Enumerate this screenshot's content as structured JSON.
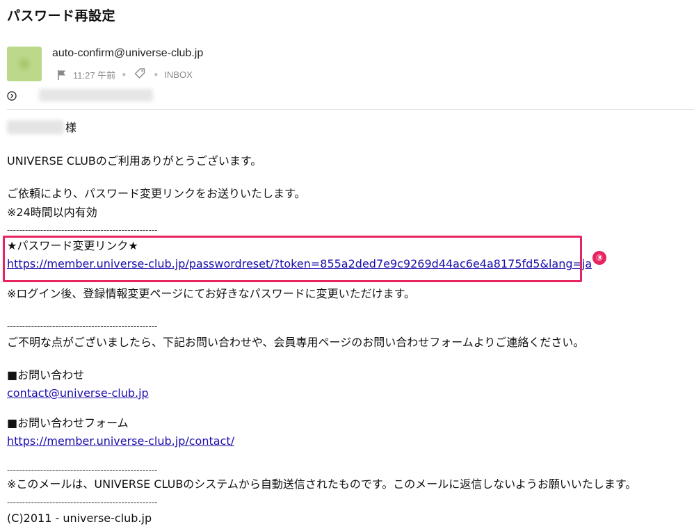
{
  "email": {
    "subject": "パスワード再設定",
    "sender": "auto-confirm@universe-club.jp",
    "time": "11:27 午前",
    "folder": "INBOX"
  },
  "body": {
    "salutation": "様",
    "greeting": "UNIVERSE CLUBのご利用ありがとうございます。",
    "line1": "ご依頼により、パスワード変更リンクをお送りいたします。",
    "line2": "※24時間以内有効",
    "separator": "--------------------------------------------------",
    "link_heading": "★パスワード変更リンク★",
    "reset_link": "https://member.universe-club.jp/passwordreset/?token=855a2ded7e9c9269d44ac6e4a8175fd5&lang=ja",
    "after_login": "※ログイン後、登録情報変更ページにてお好きなパスワードに変更いただけます。",
    "question": "ご不明な点がございましたら、下記お問い合わせや、会員専用ページのお問い合わせフォームよりご連絡ください。",
    "contact_heading": "■お問い合わせ",
    "contact_email": "contact@universe-club.jp",
    "form_heading": "■お問い合わせフォーム",
    "form_link": "https://member.universe-club.jp/contact/",
    "auto_note": "※このメールは、UNIVERSE CLUBのシステムから自動送信されたものです。このメールに返信しないようお願いいたします。",
    "copyright": "(C)2011 - universe-club.jp"
  },
  "annotation": {
    "step_badge": "③",
    "highlight_color": "#e8245f"
  }
}
